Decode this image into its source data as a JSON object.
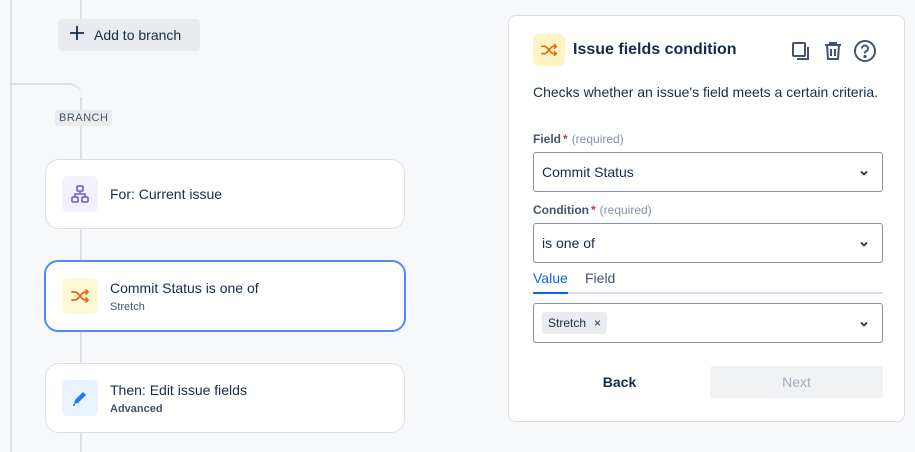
{
  "flow": {
    "add_branch_label": "Add to branch",
    "branch_tag": "BRANCH",
    "cards": [
      {
        "title": "For: Current issue",
        "subtitle": ""
      },
      {
        "title": "Commit Status is one of",
        "subtitle": "Stretch"
      },
      {
        "title": "Then: Edit issue fields",
        "subtitle": "Advanced"
      }
    ]
  },
  "panel": {
    "title": "Issue fields condition",
    "description": "Checks whether an issue's field meets a certain criteria.",
    "field": {
      "label": "Field",
      "required_mark": "*",
      "required_text": "(required)",
      "value": "Commit Status"
    },
    "condition": {
      "label": "Condition",
      "required_mark": "*",
      "required_text": "(required)",
      "value": "is one of"
    },
    "tabs": [
      {
        "label": "Value",
        "active": true
      },
      {
        "label": "Field",
        "active": false
      }
    ],
    "value_chips": [
      "Stretch"
    ],
    "chip_remove": "×",
    "back_label": "Back",
    "next_label": "Next"
  },
  "icons": {
    "add": "plus-icon",
    "hierarchy": "hierarchy-icon",
    "condition": "shuffle-icon",
    "edit": "pencil-icon",
    "copy": "copy-icon",
    "delete": "trash-icon",
    "help": "help-icon",
    "dropdown": "chevron-down-icon"
  },
  "colors": {
    "accent": "#0c66e4",
    "selected_border": "#4c8ef7",
    "condition_icon": "#e56910",
    "hierarchy_icon": "#6e5dc6",
    "edit_icon": "#1d7afc",
    "required": "#c9372c"
  }
}
